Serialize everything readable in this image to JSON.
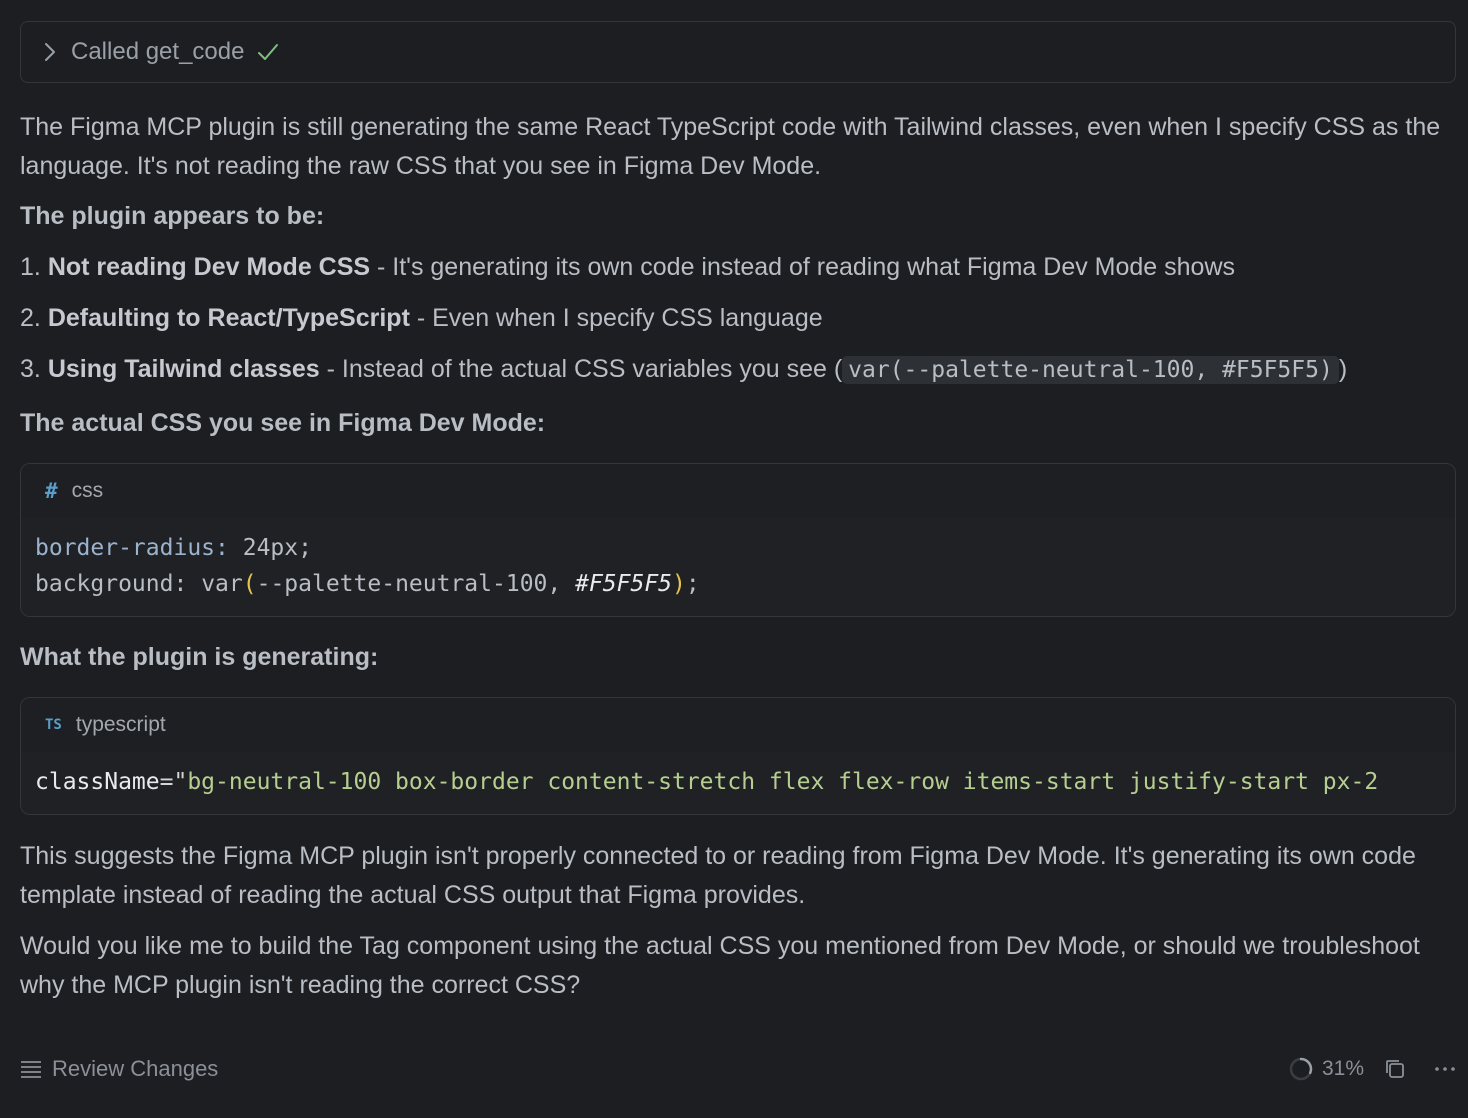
{
  "tool_call": {
    "label": "Called get_code"
  },
  "message": {
    "intro": "The Figma MCP plugin is still generating the same React TypeScript code with Tailwind classes, even when I specify CSS as the language. It's not reading the raw CSS that you see in Figma Dev Mode.",
    "heading_appears": "The plugin appears to be:",
    "points": [
      {
        "num": "1.",
        "bold": "Not reading Dev Mode CSS",
        "rest": " - It's generating its own code instead of reading what Figma Dev Mode shows"
      },
      {
        "num": "2.",
        "bold": "Defaulting to React/TypeScript",
        "rest": " - Even when I specify CSS language"
      },
      {
        "num": "3.",
        "bold": "Using Tailwind classes",
        "rest": " - Instead of the actual CSS variables you see (",
        "code": "var(--palette-neutral-100, #F5F5F5)",
        "after": ")"
      }
    ],
    "heading_actual": "The actual CSS you see in Figma Dev Mode:",
    "css_block": {
      "icon": "#",
      "lang": "css",
      "line1_prop": "border-radius",
      "line1_colon": ": ",
      "line1_value": "24px;",
      "line2_prop": "background",
      "line2_colon": ": ",
      "line2_func": "var",
      "line2_open": "(",
      "line2_var": "--palette-neutral-100, ",
      "line2_hash": "#F5F5F5",
      "line2_close": ")",
      "line2_semi": ";"
    },
    "heading_generating": "What the plugin is generating:",
    "ts_block": {
      "icon": "TS",
      "lang": "typescript",
      "attr": "className",
      "eq": "=\"",
      "value": "bg-neutral-100 box-border content-stretch flex flex-row items-start justify-start px-2"
    },
    "suggest": "This suggests the Figma MCP plugin isn't properly connected to or reading from Figma Dev Mode. It's generating its own code template instead of reading the actual CSS output that Figma provides.",
    "question": "Would you like me to build the Tag component using the actual CSS you mentioned from Dev Mode, or should we troubleshoot why the MCP plugin isn't reading the correct CSS?"
  },
  "footer": {
    "review_label": "Review Changes",
    "context_percent": "31%",
    "context_fraction": 0.31
  },
  "colors": {
    "background": "#1c1e21",
    "text": "#b9bdc4",
    "check": "#7fbf7f",
    "accent_blue": "#5b9ec9",
    "string_green": "#b6cf91",
    "paren_yellow": "#e6c44f"
  }
}
